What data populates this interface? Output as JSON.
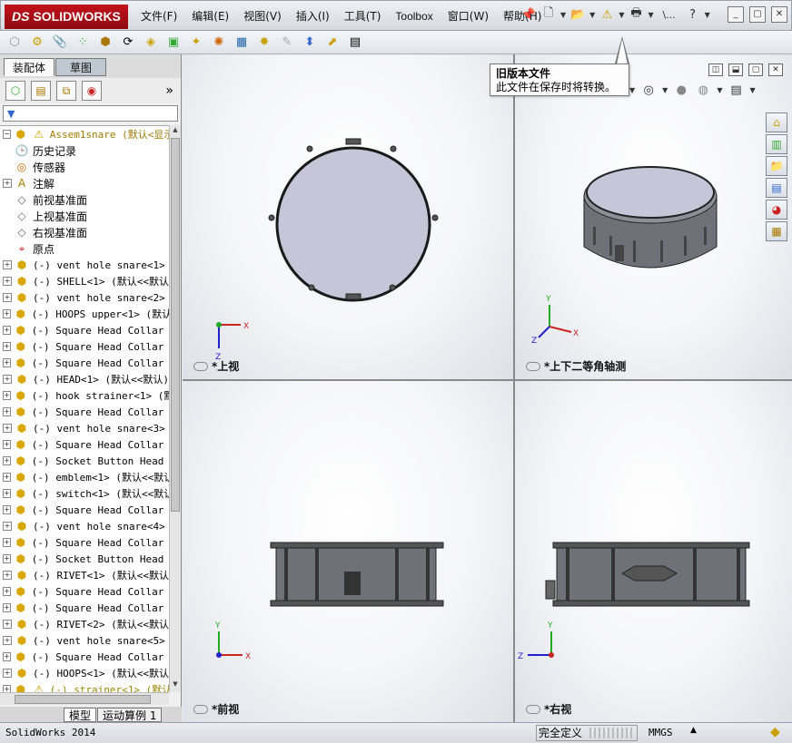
{
  "app": {
    "logo_prefix": "DS",
    "logo_text": "SOLIDWORKS",
    "status_app": "SolidWorks 2014"
  },
  "menu": [
    {
      "label": "文件(F)"
    },
    {
      "label": "编辑(E)"
    },
    {
      "label": "视图(V)"
    },
    {
      "label": "插入(I)"
    },
    {
      "label": "工具(T)"
    },
    {
      "label": "Toolbox"
    },
    {
      "label": "窗口(W)"
    },
    {
      "label": "帮助(H)"
    }
  ],
  "quickbar": {
    "search_hint": "\\..."
  },
  "tabs": {
    "assembly": "装配体",
    "sketch": "草图"
  },
  "tree": {
    "root": "Assem1snare  (默认<显示状",
    "items": [
      {
        "label": "历史记录",
        "icon": "history-icon",
        "cjk": true,
        "expand": false
      },
      {
        "label": "传感器",
        "icon": "sensor-icon",
        "cjk": true,
        "expand": false
      },
      {
        "label": "注解",
        "icon": "annotation-icon",
        "cjk": true,
        "expand": true
      },
      {
        "label": "前视基准面",
        "icon": "plane-icon",
        "cjk": true,
        "expand": false
      },
      {
        "label": "上视基准面",
        "icon": "plane-icon",
        "cjk": true,
        "expand": false
      },
      {
        "label": "右视基准面",
        "icon": "plane-icon",
        "cjk": true,
        "expand": false
      },
      {
        "label": "原点",
        "icon": "origin-icon",
        "cjk": true,
        "expand": false
      },
      {
        "label": "(-) vent hole snare<1>",
        "icon": "part-icon",
        "expand": true
      },
      {
        "label": "(-) SHELL<1> (默认<<默认",
        "icon": "part-icon",
        "expand": true
      },
      {
        "label": "(-) vent hole snare<2>",
        "icon": "part-icon",
        "expand": true
      },
      {
        "label": "(-) HOOPS upper<1> (默认",
        "icon": "part-icon",
        "expand": true
      },
      {
        "label": "(-) Square Head Collar B",
        "icon": "part-icon",
        "expand": true
      },
      {
        "label": "(-) Square Head Collar B",
        "icon": "part-icon",
        "expand": true
      },
      {
        "label": "(-) Square Head Collar B",
        "icon": "part-icon",
        "expand": true
      },
      {
        "label": "(-) HEAD<1> (默认<<默认)",
        "icon": "part-icon",
        "expand": true
      },
      {
        "label": "(-) hook strainer<1> (默",
        "icon": "part-icon",
        "expand": true
      },
      {
        "label": "(-) Square Head Collar B",
        "icon": "part-icon",
        "expand": true
      },
      {
        "label": "(-) vent hole snare<3>",
        "icon": "part-icon",
        "expand": true
      },
      {
        "label": "(-) Square Head Collar B",
        "icon": "part-icon",
        "expand": true
      },
      {
        "label": "(-) Socket Button Head S",
        "icon": "part-icon",
        "expand": true
      },
      {
        "label": "(-) emblem<1> (默认<<默认",
        "icon": "part-icon",
        "expand": true
      },
      {
        "label": "(-) switch<1> (默认<<默认",
        "icon": "part-icon",
        "expand": true
      },
      {
        "label": "(-) Square Head Collar B",
        "icon": "part-icon",
        "expand": true
      },
      {
        "label": "(-) vent hole snare<4>",
        "icon": "part-icon",
        "expand": true
      },
      {
        "label": "(-) Square Head Collar B",
        "icon": "part-icon",
        "expand": true
      },
      {
        "label": "(-) Socket Button Head S",
        "icon": "part-icon",
        "expand": true
      },
      {
        "label": "(-) RIVET<1> (默认<<默认",
        "icon": "part-icon",
        "expand": true
      },
      {
        "label": "(-) Square Head Collar B",
        "icon": "part-icon",
        "expand": true
      },
      {
        "label": "(-) Square Head Collar B",
        "icon": "part-icon",
        "expand": true
      },
      {
        "label": "(-) RIVET<2> (默认<<默认",
        "icon": "part-icon",
        "expand": true
      },
      {
        "label": "(-) vent hole snare<5>",
        "icon": "part-icon",
        "expand": true
      },
      {
        "label": "(-) Square Head Collar B",
        "icon": "part-icon",
        "expand": true
      },
      {
        "label": "(-) HOOPS<1> (默认<<默认",
        "icon": "part-icon",
        "expand": true
      },
      {
        "label": "(-) strainer<1> (默认",
        "icon": "part-warning-icon",
        "warn": true,
        "expand": true
      }
    ]
  },
  "bottom_tabs": {
    "model": "模型",
    "motion": "运动算例 1"
  },
  "views": {
    "top": "*上视",
    "iso": "*上下二等角轴测",
    "front": "*前视",
    "right": "*右视"
  },
  "tooltip": {
    "title": "旧版本文件",
    "body": "此文件在保存时将转换。"
  },
  "status": {
    "definition": "完全定义",
    "units": "MMGS"
  },
  "colors": {
    "brand_red": "#c4121c",
    "model_gray": "#6e7178",
    "head_face": "#c5c6d8"
  }
}
